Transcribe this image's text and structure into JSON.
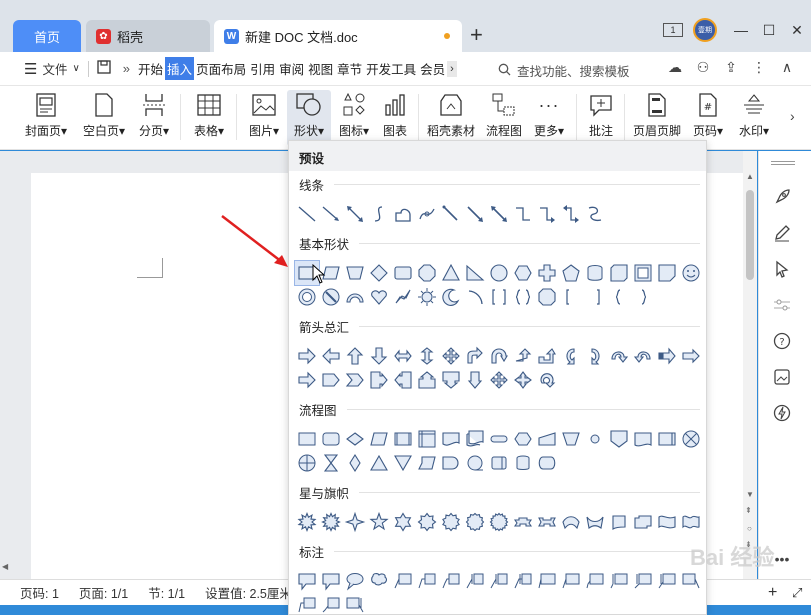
{
  "tabs": [
    {
      "label": "首页"
    },
    {
      "label": "稻壳"
    },
    {
      "label": "新建 DOC 文档.doc"
    }
  ],
  "avatar_text": "壹期",
  "menu": {
    "file": "文件",
    "items": [
      "开始",
      "插入",
      "页面布局",
      "引用",
      "审阅",
      "视图",
      "章节",
      "开发工具",
      "会员"
    ],
    "active_index": 1,
    "search_placeholder": "查找功能、搜索模板"
  },
  "ribbon": [
    {
      "label": "封面页",
      "icon": "cover-page-icon",
      "dropdown": true
    },
    {
      "label": "空白页",
      "icon": "blank-page-icon",
      "dropdown": true
    },
    {
      "label": "分页",
      "icon": "page-break-icon",
      "dropdown": true
    },
    {
      "label": "表格",
      "icon": "table-icon",
      "dropdown": true
    },
    {
      "label": "图片",
      "icon": "picture-icon",
      "dropdown": true
    },
    {
      "label": "形状",
      "icon": "shape-icon",
      "dropdown": true,
      "active": true
    },
    {
      "label": "图标",
      "icon": "icons-icon",
      "dropdown": true
    },
    {
      "label": "图表",
      "icon": "chart-icon",
      "dropdown": false
    },
    {
      "label": "稻壳素材",
      "icon": "material-icon",
      "dropdown": false
    },
    {
      "label": "流程图",
      "icon": "flowchart-icon",
      "dropdown": false
    },
    {
      "label": "更多",
      "icon": "more-icon",
      "dropdown": true
    },
    {
      "label": "批注",
      "icon": "comment-icon",
      "dropdown": false
    },
    {
      "label": "页眉页脚",
      "icon": "header-footer-icon",
      "dropdown": false
    },
    {
      "label": "页码",
      "icon": "page-number-icon",
      "dropdown": true
    },
    {
      "label": "水印",
      "icon": "watermark-icon",
      "dropdown": true
    }
  ],
  "shapes_panel": {
    "header": "预设",
    "sections": [
      {
        "title": "线条",
        "rows": [
          13
        ]
      },
      {
        "title": "基本形状",
        "rows": [
          17,
          15
        ]
      },
      {
        "title": "箭头总汇",
        "rows": [
          17,
          11
        ]
      },
      {
        "title": "流程图",
        "rows": [
          17,
          11
        ]
      },
      {
        "title": "星与旗帜",
        "rows": [
          17
        ]
      },
      {
        "title": "标注",
        "rows": [
          17,
          3
        ]
      }
    ]
  },
  "status": {
    "page_code": "页码: 1",
    "pages": "页面: 1/1",
    "section": "节: 1/1",
    "setting": "设置值: 2.5厘米"
  },
  "watermark_text": "Bai 经验",
  "colors": {
    "accent": "#3f7ee8",
    "home_tab": "#4e8ef7",
    "annotation": "#e02020"
  }
}
